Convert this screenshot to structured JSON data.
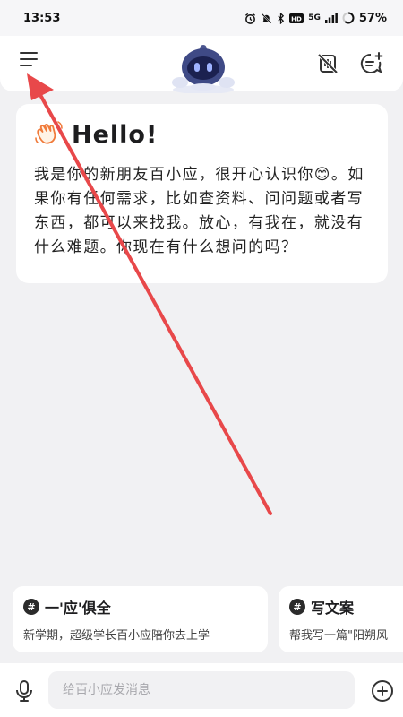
{
  "status_bar": {
    "time": "13:53",
    "battery": "57%",
    "network": "5G"
  },
  "header": {
    "menu_icon": "hamburger-menu-icon",
    "avatar_icon": "robot-avatar-icon",
    "mute_icon": "speaker-muted-icon",
    "new_chat_icon": "new-chat-icon"
  },
  "welcome": {
    "icon": "waving-hand-icon",
    "title": "Hello!",
    "text": "我是你的新朋友百小应，很开心认识你😊。如果你有任何需求，比如查资料、问问题或者写东西，都可以来找我。放心，有我在，就没有什么难题。你现在有什么想问的吗？"
  },
  "suggestions": [
    {
      "title": "一'应'俱全",
      "desc": "新学期，超级学长百小应陪你去上学"
    },
    {
      "title": "写文案",
      "desc": "帮我写一篇\"阳朔风"
    }
  ],
  "input": {
    "placeholder": "给百小应发消息"
  },
  "colors": {
    "background": "#f1f1f3",
    "card": "#ffffff",
    "annotation_arrow": "#e8484a"
  }
}
